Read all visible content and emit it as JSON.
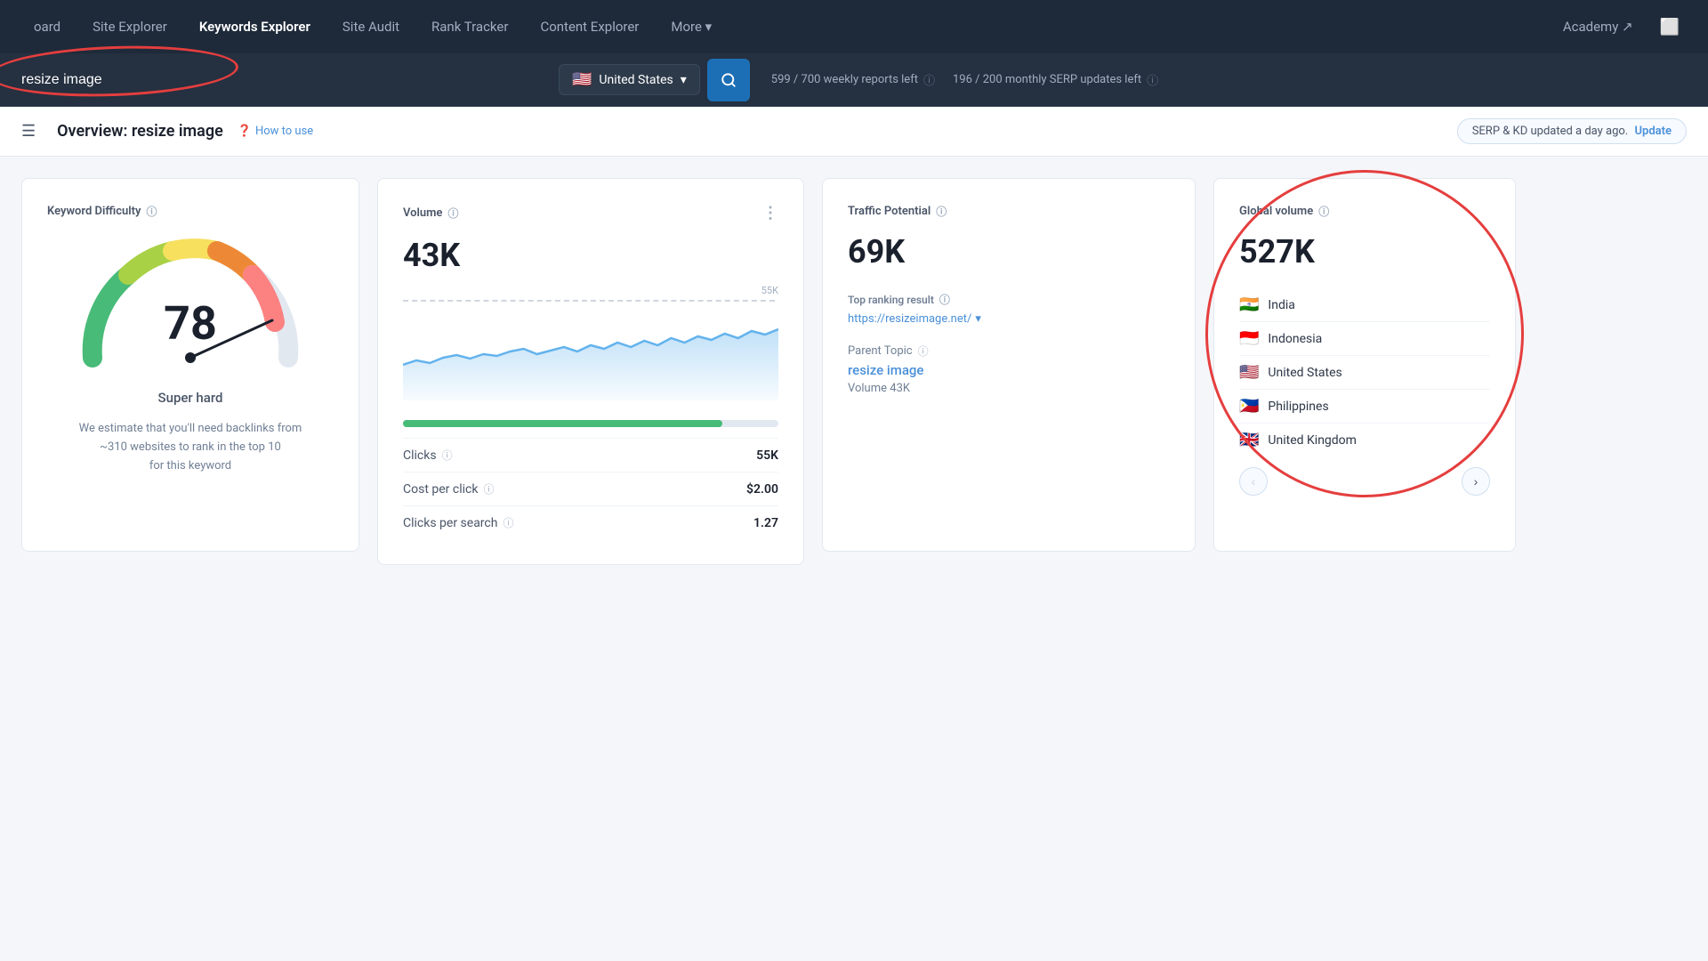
{
  "nav": {
    "items": [
      {
        "label": "oard",
        "id": "dashboard",
        "active": false
      },
      {
        "label": "Site Explorer",
        "id": "site-explorer",
        "active": false
      },
      {
        "label": "Keywords Explorer",
        "id": "keywords-explorer",
        "active": true
      },
      {
        "label": "Site Audit",
        "id": "site-audit",
        "active": false
      },
      {
        "label": "Rank Tracker",
        "id": "rank-tracker",
        "active": false
      },
      {
        "label": "Content Explorer",
        "id": "content-explorer",
        "active": false
      },
      {
        "label": "More ▾",
        "id": "more",
        "active": false
      }
    ],
    "academy_label": "Academy ↗",
    "window_icon": "⬜"
  },
  "search": {
    "placeholder": "resize image",
    "value": "resize image",
    "country": "United States",
    "country_flag": "🇺🇸",
    "reports_weekly": "599 / 700 weekly reports left",
    "reports_monthly": "196 / 200 monthly SERP updates left"
  },
  "overview": {
    "title": "Overview: resize image",
    "how_to_use": "How to use",
    "serp_update": "SERP & KD updated a day ago.",
    "update_link": "Update"
  },
  "keyword_difficulty": {
    "title": "Keyword Difficulty",
    "score": "78",
    "label": "Super hard",
    "description": "We estimate that you'll need backlinks from\n~310 websites to rank in the top 10\nfor this keyword"
  },
  "volume": {
    "title": "Volume",
    "value": "43K",
    "chart_max": "55K",
    "clicks_label": "Clicks",
    "clicks_value": "55K",
    "cpc_label": "Cost per click",
    "cpc_value": "$2.00",
    "cps_label": "Clicks per search",
    "cps_value": "1.27",
    "menu_icon": "⋮"
  },
  "traffic_potential": {
    "title": "Traffic Potential",
    "value": "69K",
    "top_ranking_label": "Top ranking result",
    "top_url": "https://resizeimage.net/",
    "parent_topic_label": "Parent Topic",
    "parent_topic_link": "resize image",
    "parent_volume_label": "Volume",
    "parent_volume_value": "43K"
  },
  "global_volume": {
    "title": "Global volume",
    "value": "527K",
    "countries": [
      {
        "flag": "🇮🇳",
        "name": "India"
      },
      {
        "flag": "🇮🇩",
        "name": "Indonesia"
      },
      {
        "flag": "🇺🇸",
        "name": "United States"
      },
      {
        "flag": "🇵🇭",
        "name": "Philippines"
      },
      {
        "flag": "🇬🇧",
        "name": "United Kingdom"
      }
    ]
  }
}
